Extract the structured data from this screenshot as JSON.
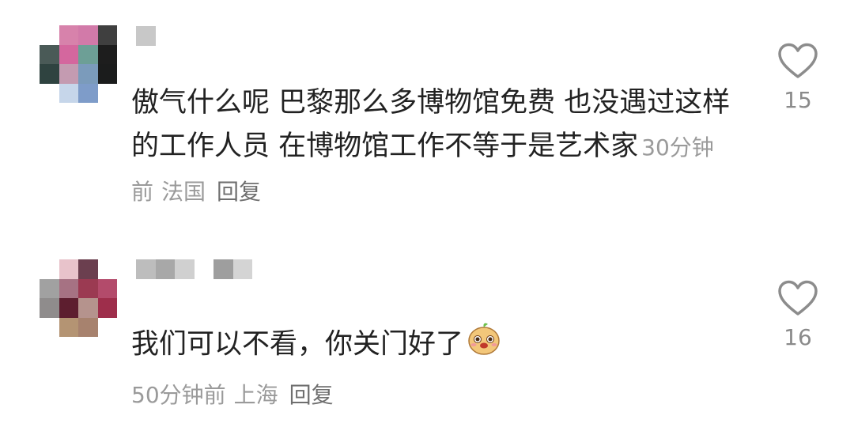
{
  "comments": [
    {
      "text": "傲气什么呢 巴黎那么多博物馆免费 也没遇过这样的工作人员 在博物馆工作不等于是艺术家",
      "time": "30分钟前",
      "location": "法国",
      "reply_label": "回复",
      "likes": "15",
      "avatar_colors": [
        "#ffffff",
        "#d782ab",
        "#d27aa9",
        "#3f3f3f",
        "#4a5a57",
        "#d4679e",
        "#6d9f96",
        "#1d1d1d",
        "#2f4340",
        "#c49bb1",
        "#7b9bbb",
        "#1b1c1c",
        "#ffffff",
        "#c6d6ea",
        "#7e9cc9",
        "#ffffff"
      ],
      "username_colors": [
        "#c8c8c8"
      ]
    },
    {
      "text": "我们可以不看，你关门好了",
      "time": "50分钟前",
      "location": "上海",
      "reply_label": "回复",
      "likes": "16",
      "avatar_colors": [
        "#ffffff",
        "#e8c3cb",
        "#6b3f4f",
        "#ffffff",
        "#a1a1a1",
        "#a67283",
        "#9b3a52",
        "#b34b6b",
        "#8f8c8c",
        "#5d1e2f",
        "#b5938d",
        "#9e2e4b",
        "#ffffff",
        "#b49473",
        "#a7826e",
        "#ffffff"
      ],
      "username_colors": [
        "#bdbdbd",
        "#a8a8a8",
        "#d0d0d0",
        "#ffffff",
        "#9e9e9e",
        "#d4d4d4"
      ],
      "emoji": "smile-sticker-icon"
    }
  ]
}
